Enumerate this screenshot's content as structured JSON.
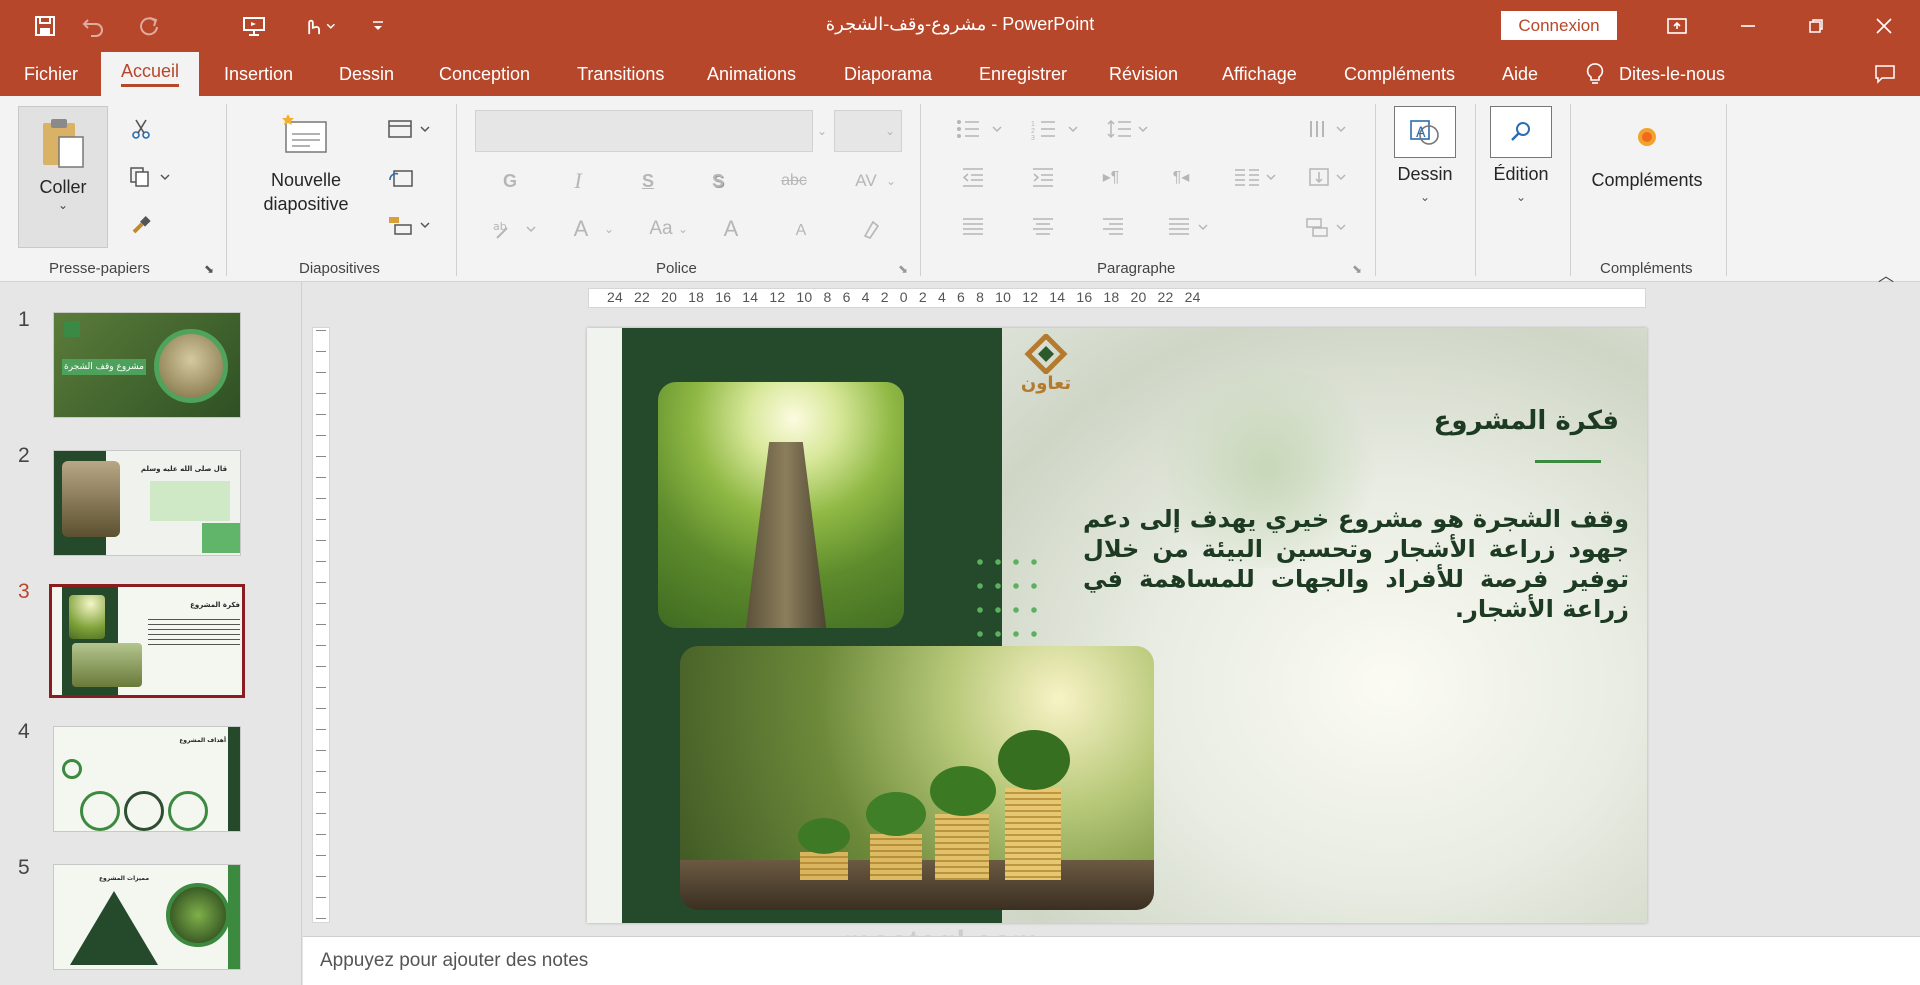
{
  "window": {
    "title": "مشروع-وقف-الشجرة  -  PowerPoint",
    "connexion_label": "Connexion",
    "accent": "#b7472a"
  },
  "quick_access": [
    "save-icon",
    "undo-icon",
    "redo-icon",
    "present-icon",
    "touch-mode-icon",
    "customize-icon"
  ],
  "tabs": [
    {
      "label": "Fichier"
    },
    {
      "label": "Accueil",
      "active": true
    },
    {
      "label": "Insertion"
    },
    {
      "label": "Dessin"
    },
    {
      "label": "Conception"
    },
    {
      "label": "Transitions"
    },
    {
      "label": "Animations"
    },
    {
      "label": "Diaporama"
    },
    {
      "label": "Enregistrer"
    },
    {
      "label": "Révision"
    },
    {
      "label": "Affichage"
    },
    {
      "label": "Compléments"
    },
    {
      "label": "Aide"
    }
  ],
  "tell_me": "Dites-le-nous",
  "ribbon": {
    "clipboard": {
      "paste_label": "Coller",
      "group_label": "Presse-papiers"
    },
    "slides": {
      "new_slide_label": "Nouvelle diapositive",
      "group_label": "Diapositives"
    },
    "font": {
      "group_label": "Police",
      "bold": "G",
      "italic": "I",
      "underline": "S",
      "shadow": "S",
      "strike": "abc",
      "spacing": "AV",
      "size_inc": "A",
      "size_dec": "A",
      "case": "Aa",
      "color": "A"
    },
    "paragraph": {
      "group_label": "Paragraphe"
    },
    "drawing": {
      "label": "Dessin"
    },
    "editing": {
      "label": "Édition"
    },
    "addins": {
      "label": "Compléments",
      "group_label": "Compléments"
    }
  },
  "thumbnails": [
    {
      "number": "1",
      "title": "مشروع وقف الشجرة"
    },
    {
      "number": "2",
      "title": "قال صلى الله عليه وسلم"
    },
    {
      "number": "3",
      "title": "فكرة المشروع",
      "active": true
    },
    {
      "number": "4",
      "title": "أهداف المشروع"
    },
    {
      "number": "5",
      "title": "مميزات المشروع"
    }
  ],
  "ruler_labels": "24 22 20 18 16 14 12 10 8 6 4 2 0 2 4 6 8 10 12 14 16 18 20 22 24",
  "slide": {
    "heading": "فكرة المشروع",
    "body": "وقف الشجرة هو مشروع خيري يهدف إلى دعم جهود زراعة الأشجار وتحسين البيئة من خلال توفير فرصة للأفراد والجهات للمساهمة في زراعة الأشجار.",
    "logo_text": "تعاون",
    "colors": {
      "dark_green": "#24492b",
      "accent_green": "#3c8a3f"
    }
  },
  "notes_placeholder": "Appuyez pour ajouter des notes",
  "watermark": "mostaql.com"
}
